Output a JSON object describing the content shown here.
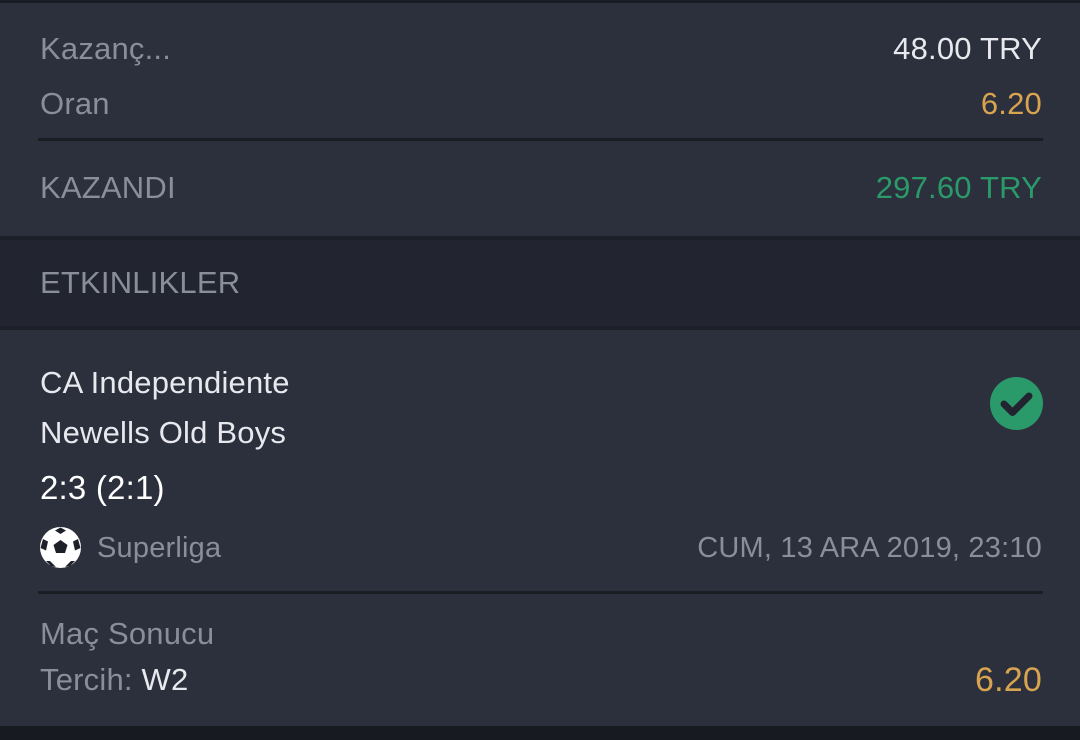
{
  "summary": {
    "winnings_label": "Kazanç...",
    "winnings_value": "48.00 TRY",
    "odds_label": "Oran",
    "odds_value": "6.20",
    "result_label": "KAZANDI",
    "result_value": "297.60 TRY"
  },
  "events_section": {
    "title": "ETKINLIKLER"
  },
  "event": {
    "home_team": "CA Independiente",
    "away_team": "Newells Old Boys",
    "score": "2:3 (2:1)",
    "league": "Superliga",
    "datetime": "CUM, 13 ARA 2019, 23:10",
    "status_icon": "check-circle-icon",
    "sport_icon": "soccer-ball-icon",
    "market": "Maç Sonucu",
    "pick_label": "Tercih:",
    "pick_value": "W2",
    "pick_odds": "6.20"
  },
  "colors": {
    "background": "#1d2029",
    "card": "#2c2f3c",
    "header": "#22252f",
    "gold": "#d8a450",
    "green": "#2b9a6a",
    "muted": "#8a8e9b",
    "light": "#e8e9ee"
  }
}
